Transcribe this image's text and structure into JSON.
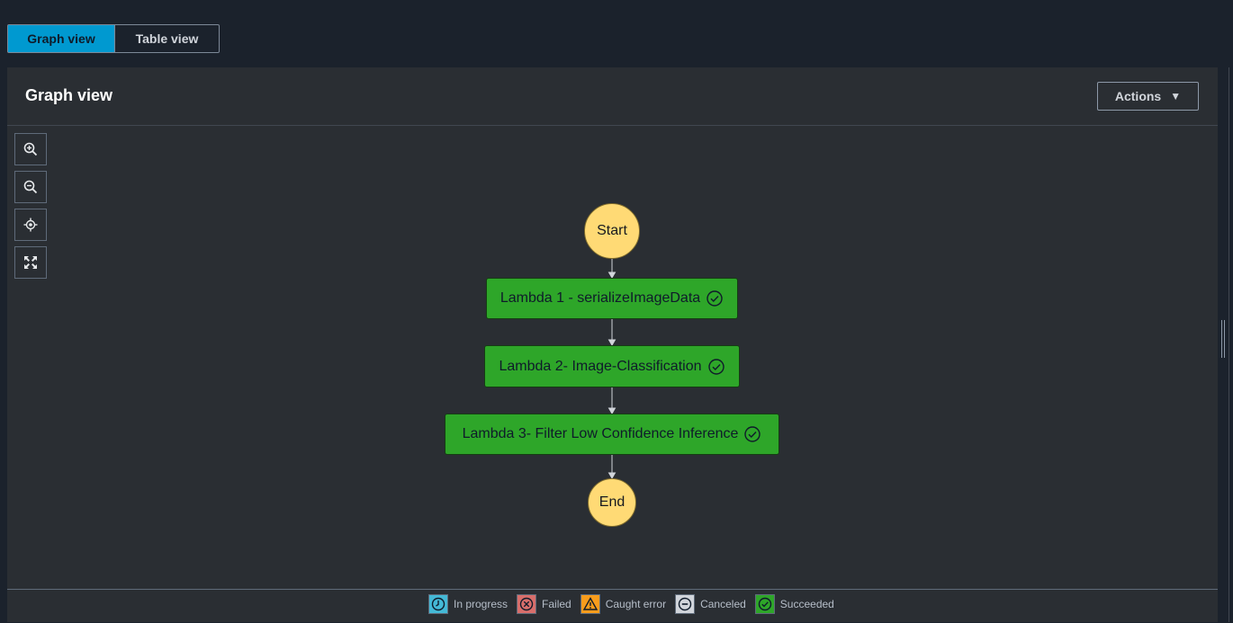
{
  "tabs": [
    {
      "label": "Graph view",
      "active": true
    },
    {
      "label": "Table view",
      "active": false
    }
  ],
  "panel": {
    "title": "Graph view",
    "actions_label": "Actions"
  },
  "zoom_controls": [
    {
      "name": "zoom-in-icon"
    },
    {
      "name": "zoom-out-icon"
    },
    {
      "name": "center-icon"
    },
    {
      "name": "fit-icon"
    }
  ],
  "graph": {
    "start_label": "Start",
    "end_label": "End",
    "states": [
      {
        "label": "Lambda 1 - serializeImageData",
        "status": "succeeded"
      },
      {
        "label": "Lambda 2- Image-Classification",
        "status": "succeeded"
      },
      {
        "label": "Lambda 3- Filter Low Confidence Inference",
        "status": "succeeded"
      }
    ]
  },
  "legend": [
    {
      "label": "In progress",
      "color": "#44b9d6",
      "icon": "clock-icon"
    },
    {
      "label": "Failed",
      "color": "#d86e6b",
      "icon": "x-circle-icon"
    },
    {
      "label": "Caught error",
      "color": "#f89c1c",
      "icon": "warning-icon"
    },
    {
      "label": "Canceled",
      "color": "#d1d5db",
      "icon": "minus-circle-icon"
    },
    {
      "label": "Succeeded",
      "color": "#2ea629",
      "icon": "check-circle-icon"
    }
  ],
  "colors": {
    "accent": "#0099d0",
    "succeeded": "#2ea629",
    "terminal": "#ffda75"
  }
}
